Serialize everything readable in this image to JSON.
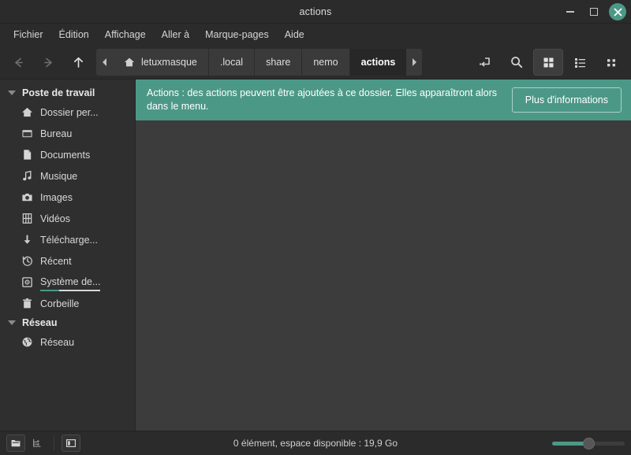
{
  "window": {
    "title": "actions",
    "buttons": {
      "minimize": "minimize-button",
      "maximize": "maximize-button",
      "close": "close-button"
    }
  },
  "colors": {
    "accent": "#4c9887",
    "titlebar_bg": "#2b2b2b",
    "sidebar_bg": "#2f2f2f",
    "content_bg": "#3c3c3c",
    "text": "#d8d8d8"
  },
  "menubar": {
    "items": [
      {
        "label": "Fichier",
        "name": "menu-fichier"
      },
      {
        "label": "Édition",
        "name": "menu-edition"
      },
      {
        "label": "Affichage",
        "name": "menu-affichage"
      },
      {
        "label": "Aller à",
        "name": "menu-aller-a"
      },
      {
        "label": "Marque-pages",
        "name": "menu-marque-pages"
      },
      {
        "label": "Aide",
        "name": "menu-aide"
      }
    ]
  },
  "toolbar": {
    "nav": {
      "back": "back-arrow-icon",
      "forward": "forward-arrow-icon",
      "up": "up-arrow-icon"
    },
    "breadcrumb": {
      "scroll_left": "chevron-left-icon",
      "scroll_right": "chevron-right-icon",
      "crumbs": [
        {
          "label": "letuxmasque",
          "icon": "home-icon",
          "active": false
        },
        {
          "label": ".local",
          "icon": "",
          "active": false
        },
        {
          "label": "share",
          "icon": "",
          "active": false
        },
        {
          "label": "nemo",
          "icon": "",
          "active": false
        },
        {
          "label": "actions",
          "icon": "",
          "active": true
        }
      ]
    },
    "actions": [
      {
        "name": "toggle-location-entry-button",
        "icon": "path-entry-icon",
        "active": false
      },
      {
        "name": "search-button",
        "icon": "search-icon",
        "active": false
      },
      {
        "name": "icon-view-button",
        "icon": "grid-view-icon",
        "active": true
      },
      {
        "name": "list-view-button",
        "icon": "list-view-icon",
        "active": false
      },
      {
        "name": "compact-view-button",
        "icon": "compact-view-icon",
        "active": false
      }
    ]
  },
  "sidebar": {
    "groups": [
      {
        "label": "Poste de travail",
        "name": "sidebar-group-poste-de-travail",
        "items": [
          {
            "label": "Dossier per...",
            "icon": "home-icon",
            "name": "sidebar-item-dossier-personnel"
          },
          {
            "label": "Bureau",
            "icon": "desktop-icon",
            "name": "sidebar-item-bureau"
          },
          {
            "label": "Documents",
            "icon": "document-icon",
            "name": "sidebar-item-documents"
          },
          {
            "label": "Musique",
            "icon": "music-note-icon",
            "name": "sidebar-item-musique"
          },
          {
            "label": "Images",
            "icon": "camera-icon",
            "name": "sidebar-item-images"
          },
          {
            "label": "Vidéos",
            "icon": "film-icon",
            "name": "sidebar-item-videos"
          },
          {
            "label": "Télécharge...",
            "icon": "download-arrow-icon",
            "name": "sidebar-item-telechargements"
          },
          {
            "label": "Récent",
            "icon": "clock-history-icon",
            "name": "sidebar-item-recent"
          },
          {
            "label": "Système de...",
            "icon": "disk-icon",
            "name": "sidebar-item-systeme-de-fichiers",
            "meter": 32
          },
          {
            "label": "Corbeille",
            "icon": "trash-icon",
            "name": "sidebar-item-corbeille"
          }
        ]
      },
      {
        "label": "Réseau",
        "name": "sidebar-group-reseau",
        "items": [
          {
            "label": "Réseau",
            "icon": "globe-icon",
            "name": "sidebar-item-reseau"
          }
        ]
      }
    ]
  },
  "notice": {
    "text": "Actions : des actions peuvent être ajoutées à ce dossier. Elles apparaîtront alors dans le menu.",
    "button_label": "Plus d'informations"
  },
  "statusbar": {
    "buttons": [
      {
        "name": "show-places-button",
        "icon": "folder-icon",
        "framed": true
      },
      {
        "name": "show-treeview-button",
        "icon": "tree-icon",
        "framed": false
      },
      {
        "name": "toggle-sidebar-button",
        "icon": "sidebar-toggle-icon",
        "framed": true
      }
    ],
    "status_text": "0 élément, espace disponible : 19,9 Go",
    "zoom": {
      "name": "zoom-slider",
      "value": 50
    }
  }
}
